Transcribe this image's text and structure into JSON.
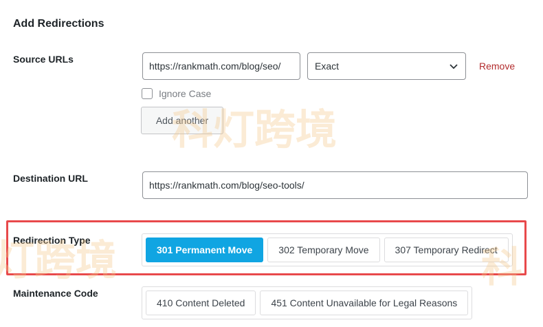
{
  "section": {
    "title": "Add Redirections"
  },
  "source": {
    "label": "Source URLs",
    "url_value": "https://rankmath.com/blog/seo/",
    "match_selected": "Exact",
    "remove_label": "Remove",
    "ignore_case_label": "Ignore Case",
    "add_another_label": "Add another"
  },
  "destination": {
    "label": "Destination URL",
    "url_value": "https://rankmath.com/blog/seo-tools/"
  },
  "redirection_type": {
    "label": "Redirection Type",
    "options": [
      {
        "label": "301 Permanent Move",
        "selected": true
      },
      {
        "label": "302 Temporary Move",
        "selected": false
      },
      {
        "label": "307 Temporary Redirect",
        "selected": false
      }
    ]
  },
  "maintenance": {
    "label": "Maintenance Code",
    "options": [
      {
        "label": "410 Content Deleted"
      },
      {
        "label": "451 Content Unavailable for Legal Reasons"
      }
    ]
  },
  "watermark": {
    "text_main": "科灯跨境",
    "text_left": "灯跨境",
    "text_right": "科"
  },
  "colors": {
    "accent": "#10a5e2",
    "remove": "#b32d2e",
    "highlight": "#e8494b"
  },
  "icons": {
    "match_dropdown": "chevron-down-icon"
  }
}
